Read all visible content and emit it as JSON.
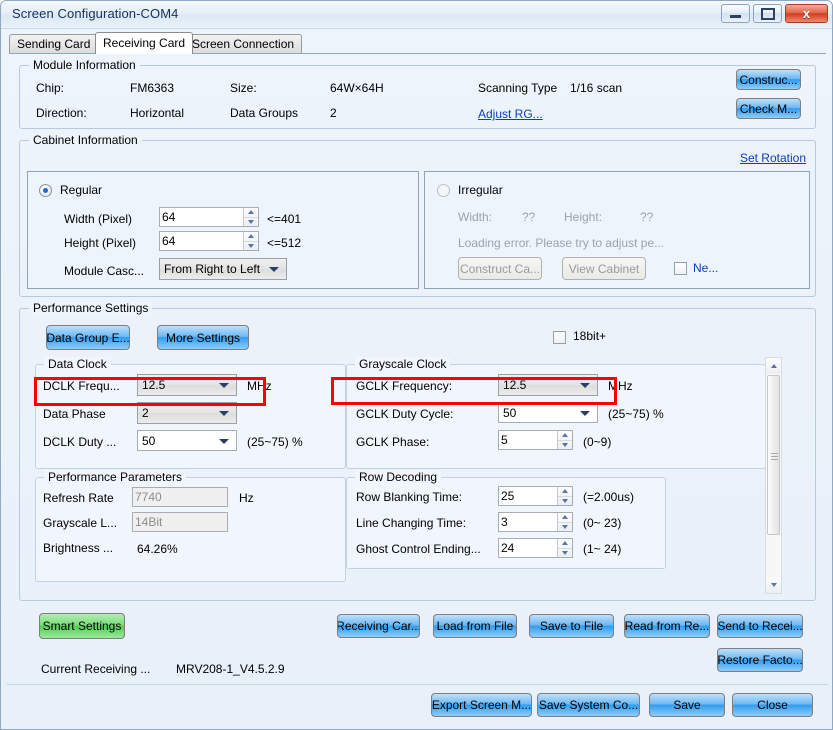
{
  "window": {
    "title": "Screen Configuration-COM4",
    "minimize_label": "Minimize",
    "maximize_label": "Maximize",
    "close_label": "x"
  },
  "tabs": [
    {
      "label": "Sending Card",
      "active": false
    },
    {
      "label": "Receiving Card",
      "active": true
    },
    {
      "label": "Screen Connection",
      "active": false
    }
  ],
  "module_information": {
    "legend": "Module Information",
    "chip_label": "Chip:",
    "chip_value": "FM6363",
    "direction_label": "Direction:",
    "direction_value": "Horizontal",
    "size_label": "Size:",
    "size_value": "64W×64H",
    "data_groups_label": "Data Groups",
    "data_groups_value": "2",
    "scanning_type_label": "Scanning Type",
    "scanning_type_value": "1/16 scan",
    "adjust_rg_link": "Adjust RG...",
    "construct_button": "Construc...",
    "check_button": "Check M..."
  },
  "cabinet_information": {
    "legend": "Cabinet Information",
    "set_rotation_link": "Set Rotation",
    "regular": {
      "radio_label": "Regular",
      "selected": true,
      "width_label": "Width (Pixel)",
      "width_value": "64",
      "width_limit": "<=401",
      "height_label": "Height (Pixel)",
      "height_value": "64",
      "height_limit": "<=512",
      "cascade_label": "Module Casc...",
      "cascade_value": "From Right to Left"
    },
    "irregular": {
      "radio_label": "Irregular",
      "selected": false,
      "width_label": "Width:",
      "width_value": "??",
      "height_label": "Height:",
      "height_value": "??",
      "error_text": "Loading error. Please try to adjust pe...",
      "construct_button": "Construct Ca...",
      "view_button": "View Cabinet",
      "checkbox_label": "Ne...",
      "checkbox_checked": false
    }
  },
  "performance_settings": {
    "legend": "Performance Settings",
    "data_group_button": "Data Group E...",
    "more_settings_button": "More Settings",
    "bit18_label": "18bit+",
    "bit18_checked": false,
    "data_clock": {
      "legend": "Data Clock",
      "dclk_freq_label": "DCLK Frequ...",
      "dclk_freq_value": "12.5",
      "dclk_freq_unit": "MHz",
      "data_phase_label": "Data Phase",
      "data_phase_value": "2",
      "dclk_duty_label": "DCLK Duty ...",
      "dclk_duty_value": "50",
      "dclk_duty_range": "(25~75) %"
    },
    "grayscale_clock": {
      "legend": "Grayscale Clock",
      "gclk_freq_label": "GCLK Frequency:",
      "gclk_freq_value": "12.5",
      "gclk_freq_unit": "MHz",
      "gclk_duty_label": "GCLK Duty Cycle:",
      "gclk_duty_value": "50",
      "gclk_duty_range": "(25~75) %",
      "gclk_phase_label": "GCLK Phase:",
      "gclk_phase_value": "5",
      "gclk_phase_range": "(0~9)"
    },
    "performance_parameters": {
      "legend": "Performance Parameters",
      "refresh_rate_label": "Refresh Rate",
      "refresh_rate_value": "7740",
      "refresh_rate_unit": "Hz",
      "grayscale_label": "Grayscale L...",
      "grayscale_value": "14Bit",
      "brightness_label": "Brightness ...",
      "brightness_value": "64.26%"
    },
    "row_decoding": {
      "legend": "Row Decoding",
      "row_blanking_label": "Row Blanking Time:",
      "row_blanking_value": "25",
      "row_blanking_range": "(=2.00us)",
      "line_changing_label": "Line Changing Time:",
      "line_changing_value": "3",
      "line_changing_range": "(0~ 23)",
      "ghost_control_label": "Ghost Control Ending...",
      "ghost_control_value": "24",
      "ghost_control_range": "(1~ 24)"
    }
  },
  "actions": {
    "smart_settings_button": "Smart Settings",
    "current_receiving_label": "Current Receiving ...",
    "current_receiving_value": "MRV208-1_V4.5.2.9",
    "receiving_card_button": "Receiving Car...",
    "load_from_file_button": "Load from File",
    "save_to_file_button": "Save to File",
    "read_from_button": "Read from Re...",
    "send_to_button": "Send to Recei...",
    "restore_factory_button": "Restore Facto..."
  },
  "footer": {
    "export_button": "Export Screen M...",
    "save_system_button": "Save System Co...",
    "save_button": "Save",
    "close_button": "Close"
  },
  "colors": {
    "accent_blue": "#2f9cf0",
    "highlight_red": "#ff0000",
    "green": "#4fcf52",
    "link": "#0b3fb5"
  }
}
